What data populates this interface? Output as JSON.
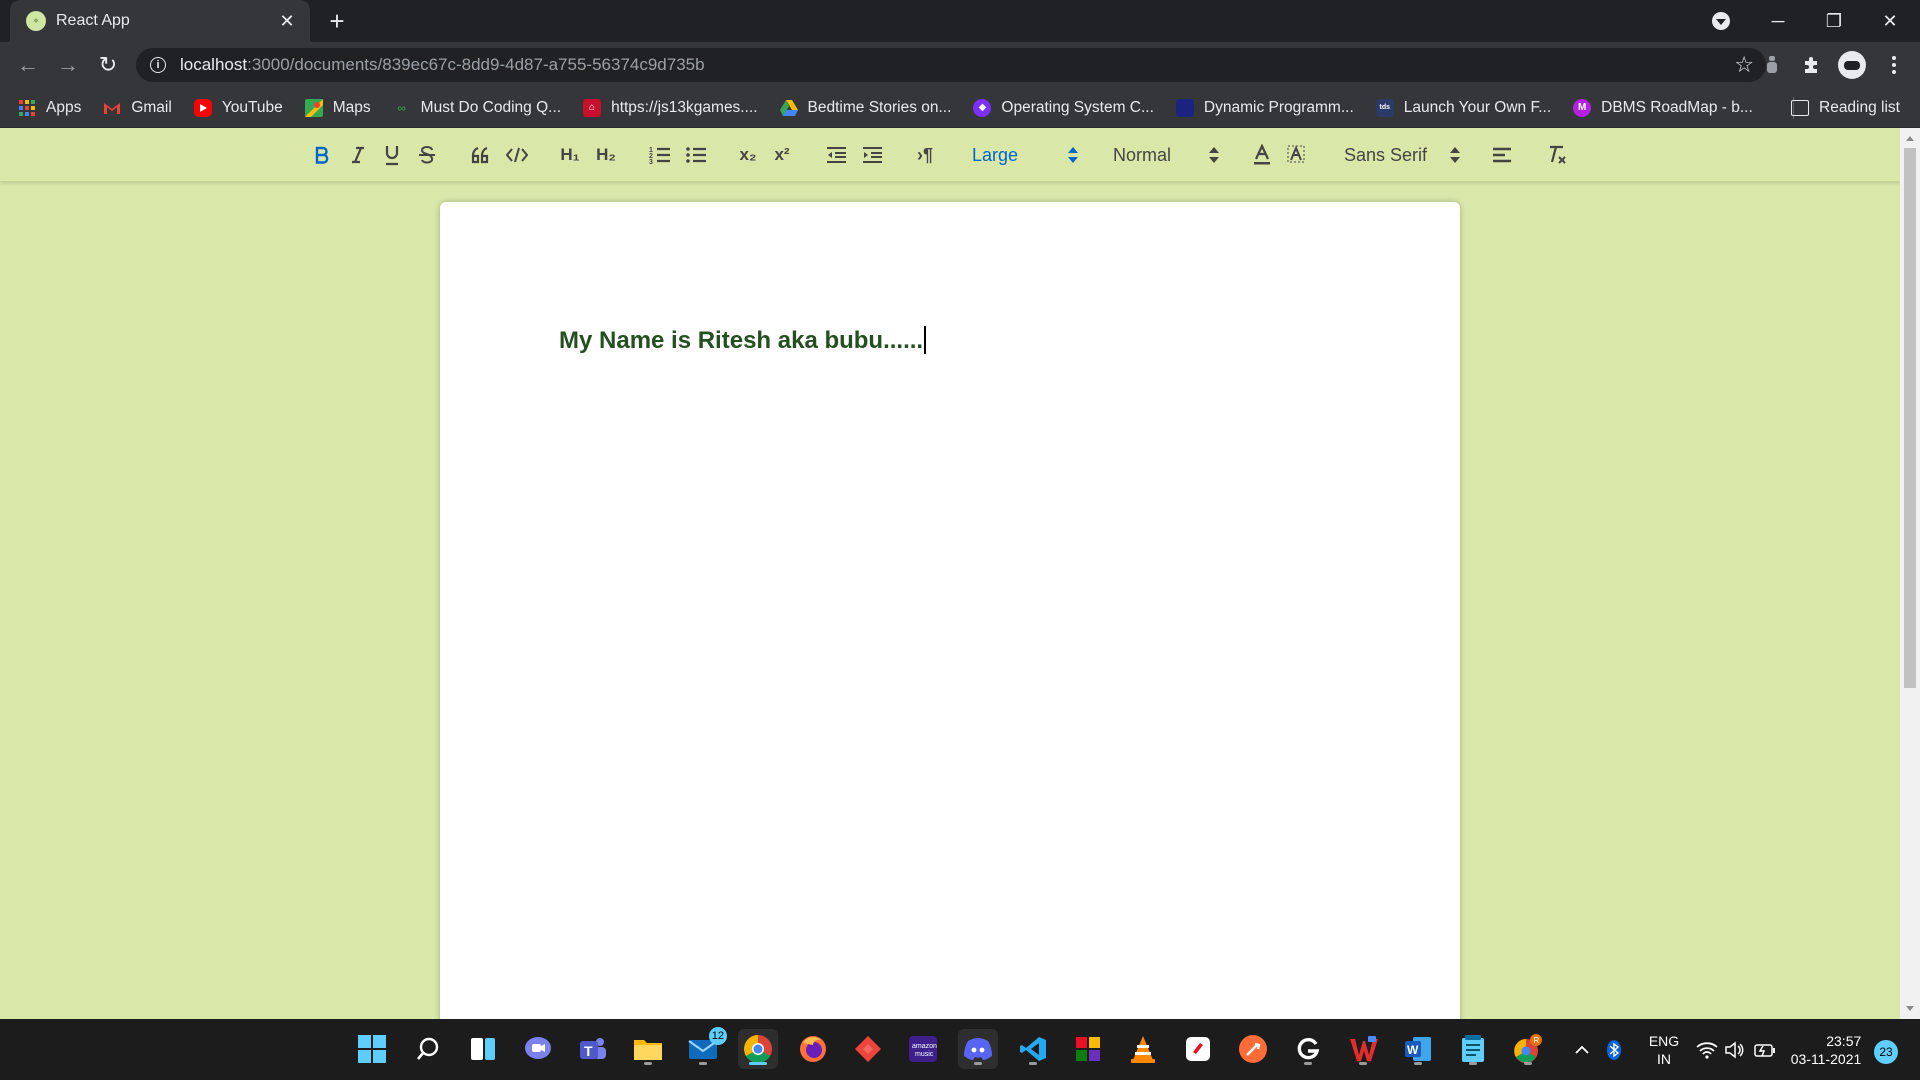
{
  "browser": {
    "tab": {
      "title": "React App",
      "favicon": "react-app-favicon"
    },
    "address": {
      "host": "localhost",
      "path": ":3000/documents/839ec67c-8dd9-4d87-a755-56374c9d735b"
    }
  },
  "bookmarks": {
    "items": [
      {
        "label": "Apps",
        "icon": "apps-grid-icon",
        "color": "#ea4335"
      },
      {
        "label": "Gmail",
        "icon": "gmail-icon",
        "color": "#ea4335"
      },
      {
        "label": "YouTube",
        "icon": "youtube-icon",
        "color": "#ff0000"
      },
      {
        "label": "Maps",
        "icon": "maps-icon",
        "color": "#34a853"
      },
      {
        "label": "Must Do Coding Q...",
        "icon": "geeksforgeeks-icon",
        "color": "#2f8d46"
      },
      {
        "label": "https://js13kgames....",
        "icon": "js13k-icon",
        "color": "#c8102e"
      },
      {
        "label": "Bedtime Stories on...",
        "icon": "drive-icon",
        "color": "#fbbc04"
      },
      {
        "label": "Operating System C...",
        "icon": "site-icon",
        "color": "#7b2ff7"
      },
      {
        "label": "Dynamic Programm...",
        "icon": "site-icon",
        "color": "#1a237e"
      },
      {
        "label": "Launch Your Own F...",
        "icon": "site-icon",
        "color": "#2b3a67"
      },
      {
        "label": "DBMS RoadMap - b...",
        "icon": "site-icon",
        "color": "#b620e0"
      }
    ],
    "reading_list": "Reading list"
  },
  "editor_toolbar": {
    "size_picker": "Large",
    "header_picker": "Normal",
    "font_picker": "Sans Serif"
  },
  "document": {
    "text": "My Name is Ritesh aka bubu......"
  },
  "taskbar": {
    "mail_badge": "12",
    "language": "ENG",
    "region": "IN",
    "time": "23:57",
    "date": "03-11-2021",
    "notifications": "23"
  },
  "colors": {
    "page_background": "#d9e8a9",
    "document_text": "#245021",
    "active_format": "#0066cc"
  }
}
